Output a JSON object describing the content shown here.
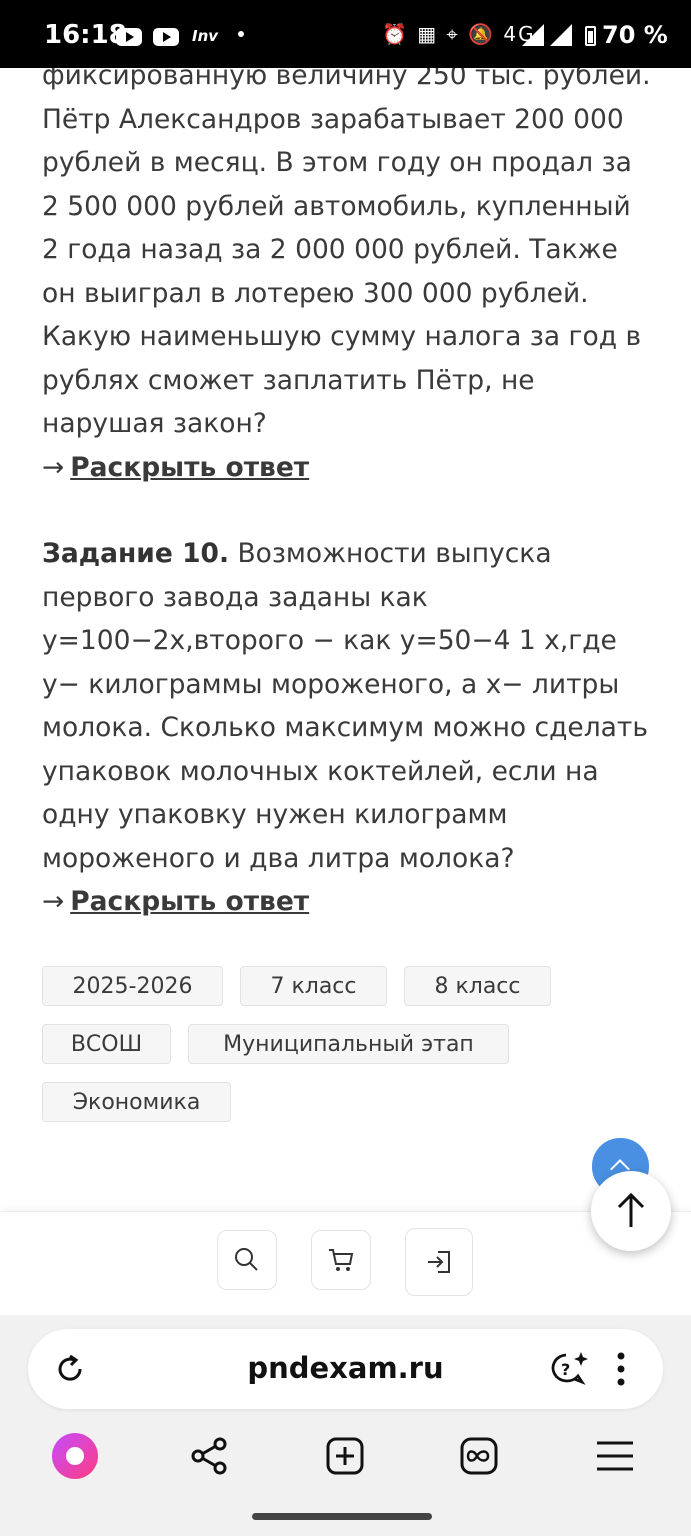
{
  "status_bar": {
    "time": "16:18",
    "app_badge": "Inv",
    "indicators": "⏰ ▦ ⌖ 🔕 4G",
    "battery": "70 %"
  },
  "article": {
    "task9_text": "фиксированную величину 250 тыс. рублей. Пётр Александров зарабатывает 200 000 рублей в месяц. В этом году он продал за 2 500 000 рублей автомобиль, купленный 2 года назад за 2 000 000 рублей. Также он выиграл в лотерею 300 000 рублей. Какую наименьшую сумму налога за год в рублях сможет заплатить Пётр, не нарушая закон?",
    "task10_label": "Задание 10.",
    "task10_text": " Возможности выпуска первого завода заданы как y=100−2x,второго − как y=50−4 1  x,где y− килограммы мороженого, а x− литры молока. Сколько максимум можно сделать упаковок молочных коктейлей, если на одну упаковку нужен килограмм мороженого и два литра молока?",
    "reveal_arrow": "→",
    "reveal_label": "Раскрыть ответ"
  },
  "tags": [
    "2025-2026",
    "7 класс",
    "8 класс",
    "ВСОШ",
    "Муниципальный этап",
    "Экономика"
  ],
  "browser": {
    "url": "pndexam.ru"
  },
  "colors": {
    "accent": "#4a90e2",
    "alice": "#ff3d7f"
  }
}
